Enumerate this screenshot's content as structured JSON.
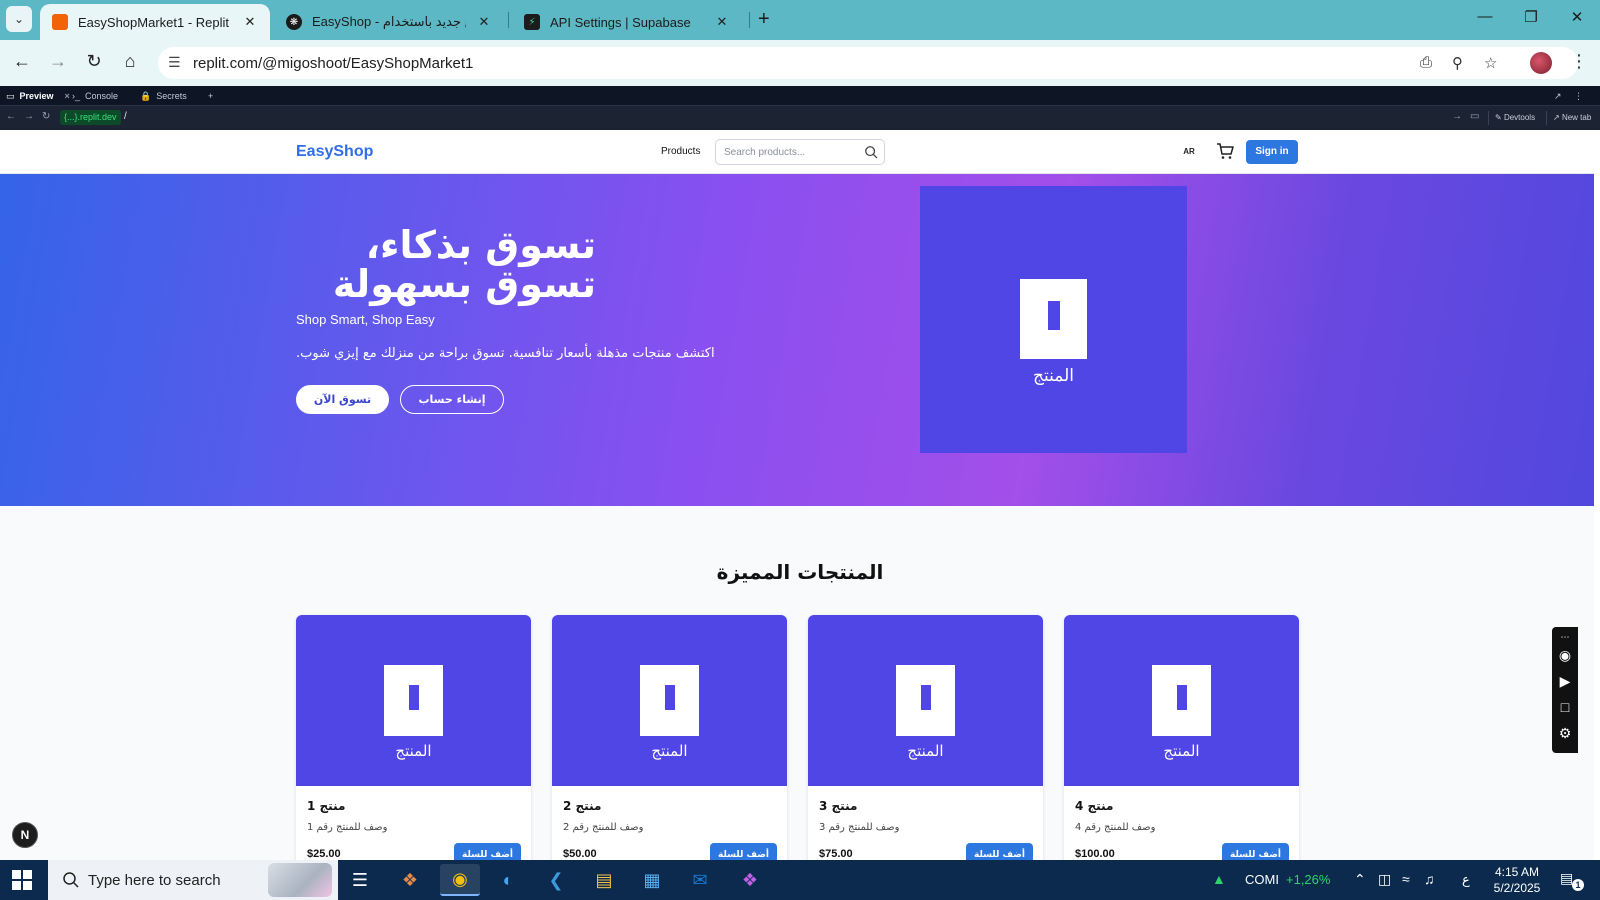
{
  "browser": {
    "tabs": [
      {
        "title": "EasyShopMarket1 - Replit",
        "favicon": "replit-icon",
        "active": true
      },
      {
        "title": "EasyShop - موقع جديد باستخدام",
        "favicon": "chatgpt-icon",
        "active": false
      },
      {
        "title": "API Settings | Supabase",
        "favicon": "supabase-icon",
        "active": false
      }
    ],
    "url": "replit.com/@migoshoot/EasyShopMarket1"
  },
  "replit": {
    "tabs": [
      {
        "label": "Preview",
        "icon": "monitor-icon"
      },
      {
        "label": "Console",
        "icon": "terminal-icon"
      },
      {
        "label": "Secrets",
        "icon": "lock-icon"
      }
    ],
    "domain": "{...}.replit.dev",
    "path": "/",
    "devtools_label": "Devtools",
    "newtab_label": "New tab"
  },
  "site": {
    "brand": "EasyShop",
    "nav_products": "Products",
    "search_placeholder": "Search products...",
    "lang": "AR",
    "signin": "Sign in"
  },
  "hero": {
    "title_line1": "تسوق بذكاء،",
    "title_line2": "تسوق بسهولة",
    "subtitle": "Shop Smart, Shop Easy",
    "description": "اكتشف منتجات مذهلة بأسعار تنافسية. تسوق براحة من منزلك مع إيزي شوب.",
    "primary_cta": "تسوق الآن",
    "secondary_cta": "إنشاء حساب",
    "image_label": "المنتج"
  },
  "featured": {
    "title": "المنتجات المميزة",
    "products": [
      {
        "name": "منتج 1",
        "description": "وصف للمنتج رقم 1",
        "price": "$25.00",
        "image_label": "المنتج",
        "button": "أضف للسلة"
      },
      {
        "name": "منتج 2",
        "description": "وصف للمنتج رقم 2",
        "price": "$50.00",
        "image_label": "المنتج",
        "button": "أضف للسلة"
      },
      {
        "name": "منتج 3",
        "description": "وصف للمنتج رقم 3",
        "price": "$75.00",
        "image_label": "المنتج",
        "button": "أضف للسلة"
      },
      {
        "name": "منتج 4",
        "description": "وصف للمنتج رقم 4",
        "price": "$100.00",
        "image_label": "المنتج",
        "button": "أضف للسلة"
      }
    ]
  },
  "overlay": {
    "next_badge": "N"
  },
  "taskbar": {
    "search_placeholder": "Type here to search",
    "stock_name": "COMI",
    "stock_change": "+1,26%",
    "ime_indicator": "ع",
    "time": "4:15 AM",
    "date": "5/2/2025",
    "notification_count": "1"
  },
  "colors": {
    "tabstrip": "#5cb8c4",
    "brand": "#2f6ee6",
    "product_tile": "#4f46e5",
    "signin": "#2d77e0",
    "taskbar": "#0b2a4d",
    "stock_up": "#2fd16b"
  }
}
